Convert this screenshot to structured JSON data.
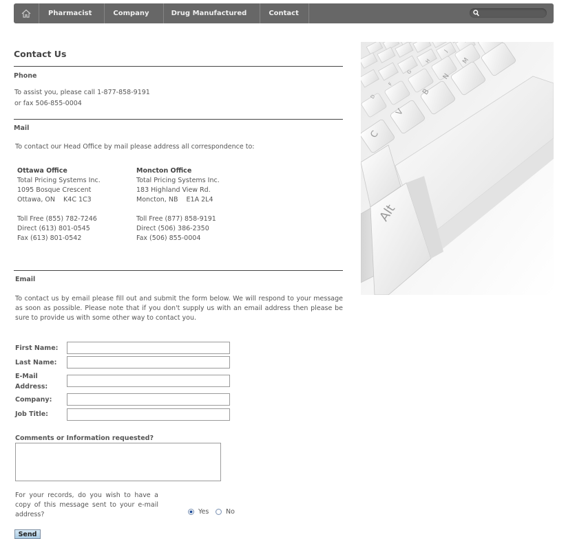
{
  "nav": {
    "home_icon": "home-icon",
    "items": [
      "Pharmacist",
      "Company",
      "Drug Manufactured",
      "Contact"
    ],
    "search": {
      "placeholder": "",
      "value": "",
      "icon": "search-icon"
    }
  },
  "page": {
    "title": "Contact Us"
  },
  "phone": {
    "heading": "Phone",
    "line1": "To assist you, please call 1-877-858-9191",
    "line2": "or fax 506-855-0004"
  },
  "mail": {
    "heading": "Mail",
    "intro": "To contact our Head Office by mail please address all correspondence to:",
    "offices": [
      {
        "name": "Ottawa Office",
        "company": "Total Pricing Systems Inc.",
        "street": "1095 Bosque Crescent",
        "city": "Ottawa, ON    K4C 1C3",
        "tollfree": "Toll Free (855) 782-7246",
        "direct": "Direct (613) 801-0545",
        "fax": "Fax (613) 801-0542"
      },
      {
        "name": "Moncton Office",
        "company": "Total Pricing Systems Inc.",
        "street": "183 Highland View Rd.",
        "city": "Moncton, NB    E1A 2L4",
        "tollfree": "Toll Free (877) 858-9191",
        "direct": "Direct (506) 386-2350",
        "fax": "Fax (506) 855-0004"
      }
    ]
  },
  "email": {
    "heading": "Email",
    "intro": "To contact us by email please fill out and submit the form below.  We will respond to your message as soon as possible.  Please note that if you don't supply us with an email address then please be sure to provide us with some other way to contact you."
  },
  "form": {
    "first_name": {
      "label": "First Name:",
      "value": ""
    },
    "last_name": {
      "label": "Last Name:",
      "value": ""
    },
    "email_l1": "E-Mail",
    "email_l2": "Address:",
    "email_value": "",
    "company": {
      "label": "Company:",
      "value": ""
    },
    "job_title": {
      "label": "Job Title:",
      "value": ""
    },
    "comments_label": "Comments or Information requested?",
    "comments_value": "",
    "copy_question": "For your records, do you wish to have a copy of this message sent to your e-mail address?",
    "yes_label": "Yes",
    "no_label": "No",
    "selected": "Yes",
    "send_label": "Send"
  },
  "hero": {
    "keys": [
      "Alt",
      "C",
      "V",
      "B",
      "N",
      "M",
      "D",
      "F",
      "G",
      "H",
      "J",
      "K"
    ]
  },
  "colors": {
    "nav_bg": "#676767",
    "nav_text": "#f0f0f0",
    "text": "#555555",
    "rule": "#444444"
  }
}
